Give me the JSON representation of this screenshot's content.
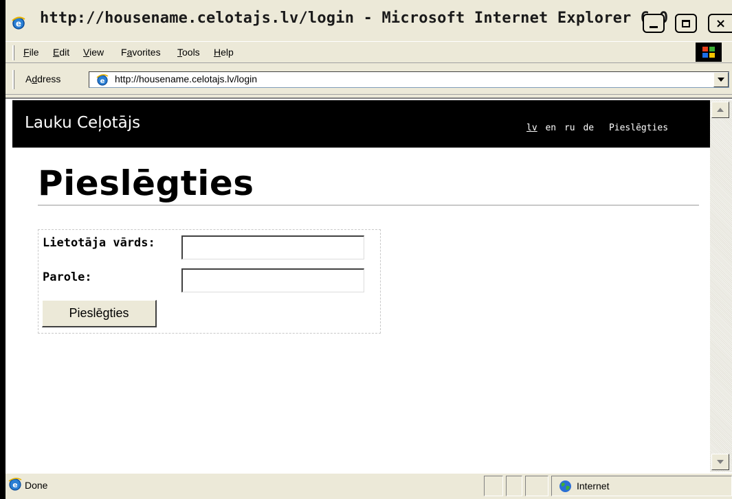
{
  "window": {
    "title": "http://housename.celotajs.lv/login - Microsoft Internet Explorer 6.0",
    "buttons": {
      "minimize": "minimize-icon",
      "maximize": "maximize-icon",
      "close": "close-icon",
      "close_glyph": "×"
    }
  },
  "menu": {
    "items": [
      {
        "label": "File",
        "underline": "F"
      },
      {
        "label": "Edit",
        "underline": "E"
      },
      {
        "label": "View",
        "underline": "V"
      },
      {
        "label": "Favorites",
        "underline": "a"
      },
      {
        "label": "Tools",
        "underline": "T"
      },
      {
        "label": "Help",
        "underline": "H"
      }
    ]
  },
  "address": {
    "label": "Address",
    "url": "http://housename.celotajs.lv/login"
  },
  "site": {
    "title": "Lauku Ceļotājs",
    "languages": [
      "lv",
      "en",
      "ru",
      "de"
    ],
    "active_language": "lv",
    "login_link": "Pieslēgties"
  },
  "page": {
    "heading": "Pieslēgties",
    "form": {
      "username_label": "Lietotāja vārds:",
      "username_value": "",
      "password_label": "Parole:",
      "password_value": "",
      "submit_label": "Pieslēgties"
    }
  },
  "status": {
    "text": "Done",
    "zone": "Internet"
  },
  "colors": {
    "header_bg": "#000000",
    "chrome": "#ece9d8"
  }
}
